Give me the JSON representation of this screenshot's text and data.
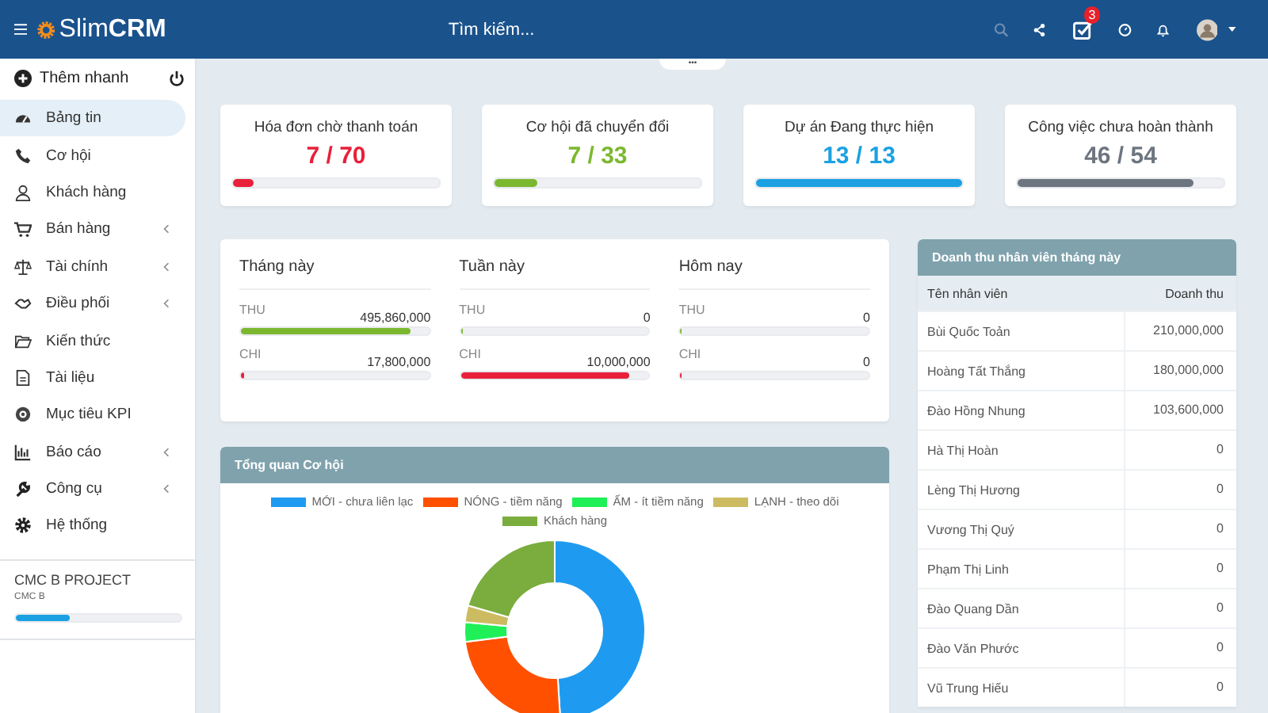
{
  "header": {
    "brand_light": "Slim",
    "brand_bold": "CRM",
    "search": {
      "placeholder": "Tìm kiếm..."
    },
    "task_badge": "3",
    "more_tab": "•••"
  },
  "sidebar": {
    "quick_add": "Thêm nhanh",
    "items": [
      {
        "label": "Bảng tin",
        "selected": true,
        "submenu": false
      },
      {
        "label": "Cơ hội",
        "selected": false,
        "submenu": false
      },
      {
        "label": "Khách hàng",
        "selected": false,
        "submenu": false
      },
      {
        "label": "Bán hàng",
        "selected": false,
        "submenu": true
      },
      {
        "label": "Tài chính",
        "selected": false,
        "submenu": true
      },
      {
        "label": "Điều phối",
        "selected": false,
        "submenu": true
      },
      {
        "label": "Kiến thức",
        "selected": false,
        "submenu": false
      },
      {
        "label": "Tài liệu",
        "selected": false,
        "submenu": false
      },
      {
        "label": "Mục tiêu KPI",
        "selected": false,
        "submenu": false
      },
      {
        "label": "Báo cáo",
        "selected": false,
        "submenu": true
      },
      {
        "label": "Công cụ",
        "selected": false,
        "submenu": true
      },
      {
        "label": "Hệ thống",
        "selected": false,
        "submenu": false
      }
    ],
    "project": {
      "name": "CMC B PROJECT",
      "code": "CMC B",
      "level": 0.33
    }
  },
  "stats": [
    {
      "title": "Hóa đơn chờ thanh toán",
      "value": "7 / 70",
      "color": "#e8203a",
      "level": 0.1
    },
    {
      "title": "Cơ hội đã chuyển đổi",
      "value": "7 / 33",
      "color": "#7cb82f",
      "level": 0.21
    },
    {
      "title": "Dự án Đang thực hiện",
      "value": "13 / 13",
      "color": "#1ba1e2",
      "level": 1
    },
    {
      "title": "Công việc chưa hoàn thành",
      "value": "46 / 54",
      "color": "#6d7580",
      "level": 0.85
    }
  ],
  "finance": [
    {
      "title": "Tháng này",
      "rows": [
        {
          "label": "THU",
          "amount": "495,860,000",
          "level": 0.9,
          "color": "#7cb82f"
        },
        {
          "label": "CHI",
          "amount": "17,800,000",
          "level": 0.02,
          "color": "#e8203a"
        }
      ]
    },
    {
      "title": "Tuần này",
      "rows": [
        {
          "label": "THU",
          "amount": "0",
          "level": 0,
          "color": "#7cb82f"
        },
        {
          "label": "CHI",
          "amount": "10,000,000",
          "level": 0.9,
          "color": "#e8203a"
        }
      ]
    },
    {
      "title": "Hôm nay",
      "rows": [
        {
          "label": "THU",
          "amount": "0",
          "level": 0,
          "color": "#7cb82f"
        },
        {
          "label": "CHI",
          "amount": "0",
          "level": 0,
          "color": "#e8203a"
        }
      ]
    }
  ],
  "opportunities": {
    "title": "Tổng quan Cơ hội",
    "legend": [
      {
        "label": "MỚI - chưa liên lạc",
        "color": "#1e9bf0"
      },
      {
        "label": "NÓNG - tiềm năng",
        "color": "#ff5000"
      },
      {
        "label": "ẤM - ít tiềm năng",
        "color": "#1ff057"
      },
      {
        "label": "LẠNH - theo dõi",
        "color": "#cdbb62"
      },
      {
        "label": "Khách hàng",
        "color": "#7aad3e"
      }
    ]
  },
  "revenue": {
    "title": "Doanh thu nhân viên tháng này",
    "columns": [
      "Tên nhân viên",
      "Doanh thu"
    ],
    "rows": [
      [
        "Bùi Quốc Toản",
        "210,000,000"
      ],
      [
        "Hoàng Tất Thắng",
        "180,000,000"
      ],
      [
        "Đào Hồng Nhung",
        "103,600,000"
      ],
      [
        "Hà Thị Hoàn",
        "0"
      ],
      [
        "Lèng Thị Hương",
        "0"
      ],
      [
        "Vương Thị Quý",
        "0"
      ],
      [
        "Phạm Thị Linh",
        "0"
      ],
      [
        "Đào Quang Dần",
        "0"
      ],
      [
        "Đào Văn Phước",
        "0"
      ],
      [
        "Vũ Trung Hiếu",
        "0"
      ]
    ]
  }
}
